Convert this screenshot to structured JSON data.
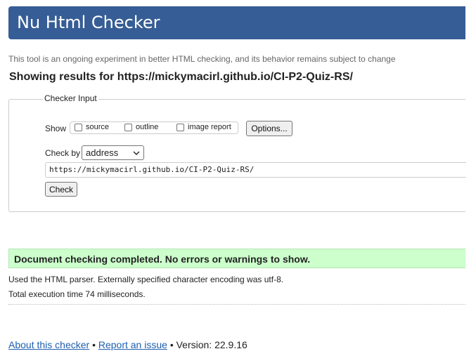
{
  "header": {
    "title": "Nu Html Checker"
  },
  "tagline": "This tool is an ongoing experiment in better HTML checking, and its behavior remains subject to change",
  "results_heading": "Showing results for https://mickymacirl.github.io/CI-P2-Quiz-RS/",
  "checker_input": {
    "legend": "Checker Input",
    "show_label": "Show",
    "show_options": [
      {
        "label": "source",
        "checked": false
      },
      {
        "label": "outline",
        "checked": false
      },
      {
        "label": "image report",
        "checked": false
      }
    ],
    "options_button": "Options...",
    "check_by_label": "Check by",
    "check_by_value": "address",
    "url_value": "https://mickymacirl.github.io/CI-P2-Quiz-RS/",
    "check_button": "Check"
  },
  "result": {
    "message": "Document checking completed. No errors or warnings to show.",
    "color": "#ccffcc"
  },
  "info_lines": [
    "Used the HTML parser. Externally specified character encoding was utf-8.",
    "Total execution time 74 milliseconds."
  ],
  "footer": {
    "about_link": "About this checker",
    "separator": "•",
    "report_link": "Report an issue",
    "version": "Version: 22.9.16"
  },
  "colors": {
    "banner": "#365d95",
    "link": "#1f5fb0"
  }
}
